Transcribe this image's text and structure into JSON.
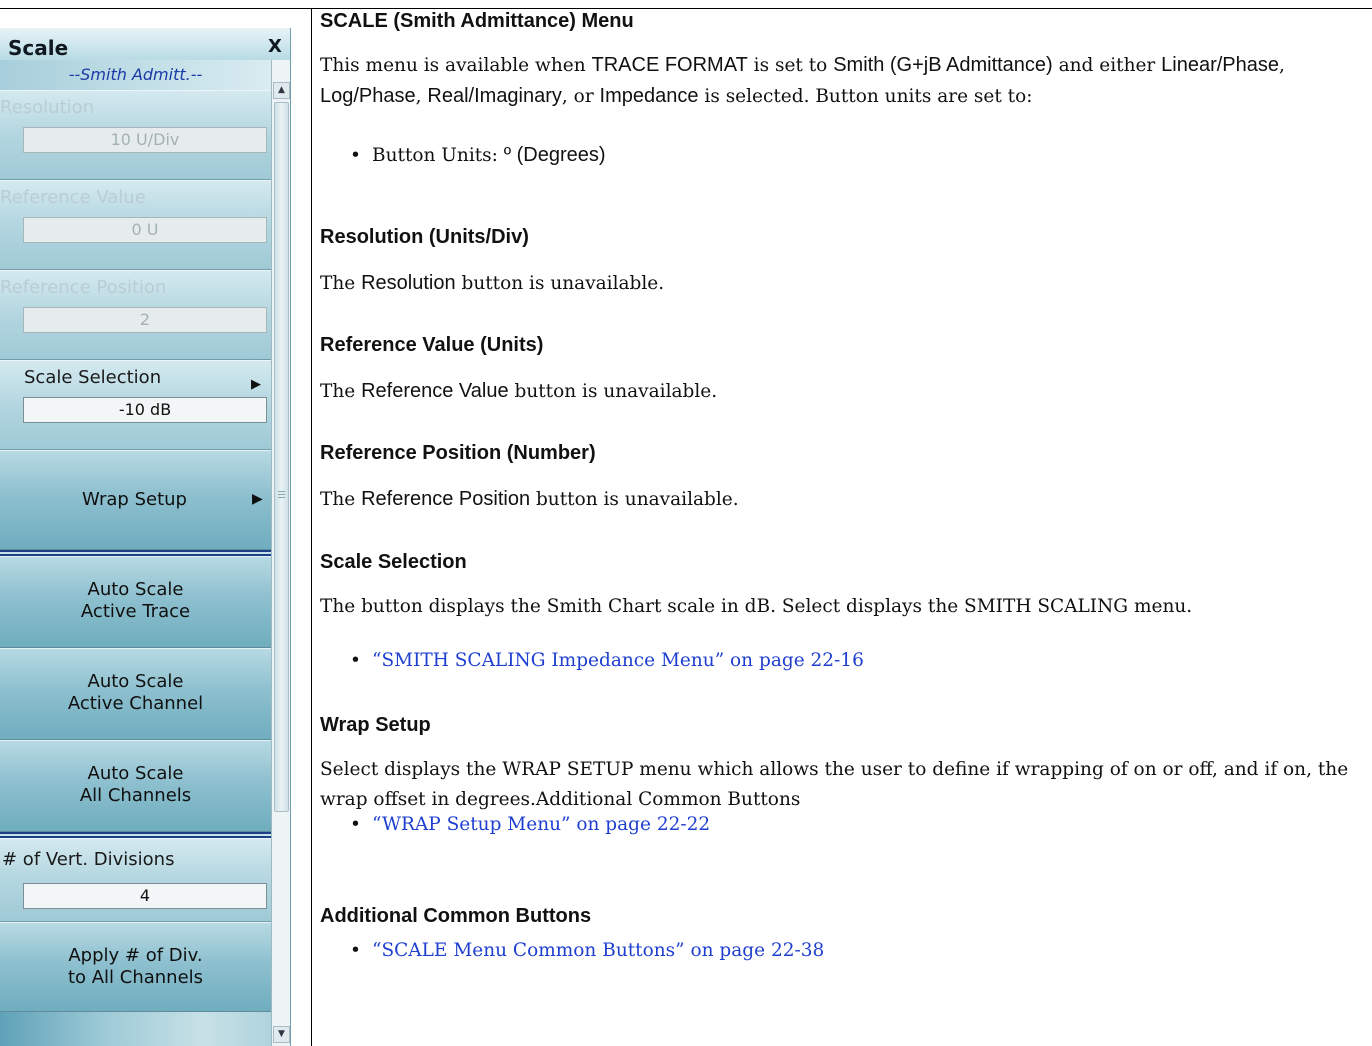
{
  "panel": {
    "title": "Scale",
    "close": "X",
    "menu_heading": "--Smith Admitt.--",
    "resolution": {
      "label": "Resolution",
      "value": "10 U/Div"
    },
    "reference_value": {
      "label": "Reference Value",
      "value": "0 U"
    },
    "reference_position": {
      "label": "Reference Position",
      "value": "2"
    },
    "scale_selection": {
      "label": "Scale Selection",
      "value": "-10 dB"
    },
    "wrap_setup": {
      "label": "Wrap Setup"
    },
    "auto_scale_trace": {
      "line1": "Auto Scale",
      "line2": "Active Trace"
    },
    "auto_scale_channel": {
      "line1": "Auto Scale",
      "line2": "Active Channel"
    },
    "auto_scale_all": {
      "line1": "Auto Scale",
      "line2": "All Channels"
    },
    "vert_divisions": {
      "label": "# of Vert. Divisions",
      "value": "4"
    },
    "apply_div": {
      "line1": "Apply # of Div.",
      "line2": "to All Channels"
    }
  },
  "doc": {
    "title": "SCALE (Smith Admittance) Menu",
    "intro": {
      "p1": "This menu is available when ",
      "trace_format": "TRACE FORMAT",
      "p2": " is set to ",
      "smith": "Smith (G+jB Admittance)",
      "p3": " and either ",
      "linear_phase": "Linear/Phase",
      "c1": ", ",
      "log_phase": "Log/Phase",
      "c2": ", ",
      "real_imag": "Real/Imaginary",
      "p4": ", or ",
      "impedance": "Impedance",
      "p5": " is selected. Button units are set to:"
    },
    "bullet_units": {
      "prefix": "Button Units: ",
      "value": "º (Degrees)"
    },
    "sec_resolution": {
      "heading": "Resolution (Units/Div)",
      "p1": "The ",
      "button": "Resolution",
      "p2": " button is unavailable."
    },
    "sec_ref_value": {
      "heading": "Reference Value (Units)",
      "p1": "The ",
      "button": "Reference Value",
      "p2": " button is unavailable."
    },
    "sec_ref_position": {
      "heading": "Reference Position (Number)",
      "p1": "The ",
      "button": "Reference Position",
      "p2": " button is unavailable."
    },
    "sec_scale_selection": {
      "heading": "Scale Selection",
      "text": "The button displays the Smith Chart scale in dB. Select displays the SMITH SCALING menu.",
      "link": "“SMITH SCALING Impedance Menu” on page 22-16"
    },
    "sec_wrap_setup": {
      "heading": "Wrap Setup",
      "text": "Select displays the WRAP SETUP menu which allows the user to define if wrapping of on or off, and if on, the wrap offset in degrees.Additional Common Buttons",
      "link": "“WRAP Setup Menu” on page 22-22"
    },
    "sec_common": {
      "heading": "Additional Common Buttons",
      "link": "“SCALE Menu Common Buttons” on page 22-38"
    }
  }
}
